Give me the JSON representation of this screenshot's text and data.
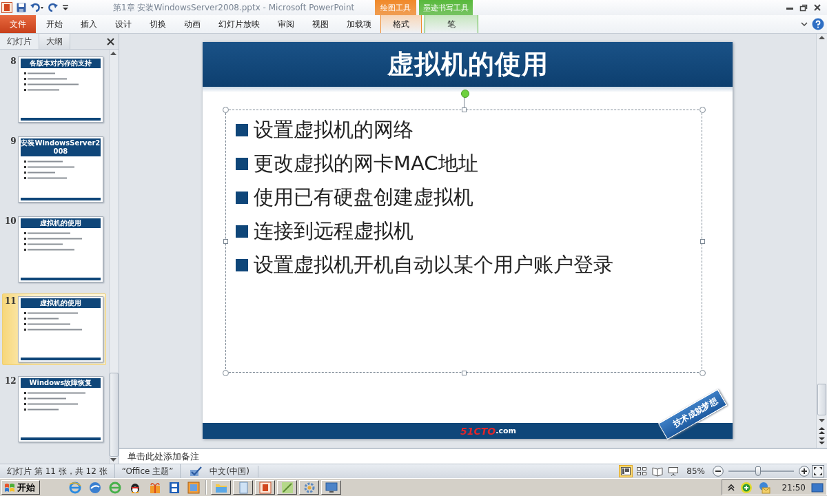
{
  "window": {
    "title": "第1章 安装WindowsServer2008.pptx  -  Microsoft PowerPoint"
  },
  "ribbon": {
    "tabs": [
      {
        "label": "文件",
        "kind": "file"
      },
      {
        "label": "开始",
        "kind": "tab"
      },
      {
        "label": "插入",
        "kind": "tab"
      },
      {
        "label": "设计",
        "kind": "tab"
      },
      {
        "label": "切换",
        "kind": "tab"
      },
      {
        "label": "动画",
        "kind": "tab"
      },
      {
        "label": "幻灯片放映",
        "kind": "tab"
      },
      {
        "label": "审阅",
        "kind": "tab"
      },
      {
        "label": "视图",
        "kind": "tab"
      },
      {
        "label": "加载项",
        "kind": "tab"
      }
    ],
    "context_groups": [
      {
        "label": "绘图工具",
        "color": "#f0892a",
        "tabs": [
          {
            "label": "格式"
          }
        ]
      },
      {
        "label": "墨迹书写工具",
        "color": "#58b83c",
        "tabs": [
          {
            "label": "笔"
          }
        ]
      }
    ]
  },
  "side_panel": {
    "tabs": [
      {
        "label": "幻灯片",
        "selected": true
      },
      {
        "label": "大纲",
        "selected": false
      }
    ],
    "slides": [
      {
        "number": "8",
        "title": "各版本对内存的支持",
        "selected": false
      },
      {
        "number": "9",
        "title": "安装WindowsServer2008",
        "selected": false
      },
      {
        "number": "10",
        "title": "虚拟机的使用",
        "selected": false
      },
      {
        "number": "11",
        "title": "虚拟机的使用",
        "selected": true
      },
      {
        "number": "12",
        "title": "Windows故障恢复",
        "selected": false
      }
    ]
  },
  "slide": {
    "title": "虚拟机的使用",
    "bullets": [
      "设置虚拟机的网络",
      "更改虚拟的网卡MAC地址",
      "使用已有硬盘创建虚拟机",
      "连接到远程虚拟机",
      "设置虚拟机开机自动以某个用户账户登录"
    ],
    "logo_main": "51CTO",
    "logo_suffix": ".com",
    "tag": "技术成就梦想"
  },
  "notes": {
    "placeholder": "单击此处添加备注"
  },
  "status_bar": {
    "slide_info": "幻灯片 第 11 张，共 12 张",
    "theme": "“Office 主题”",
    "language": "中文(中国)",
    "views": [
      {
        "kind": "normal",
        "selected": true
      },
      {
        "kind": "sorter",
        "selected": false
      },
      {
        "kind": "reading",
        "selected": false
      },
      {
        "kind": "slideshow",
        "selected": false
      }
    ],
    "zoom": "85%",
    "zoom_slider": {
      "level": 0.45
    }
  },
  "taskbar": {
    "start_label": "开始",
    "clock": "21:50"
  }
}
